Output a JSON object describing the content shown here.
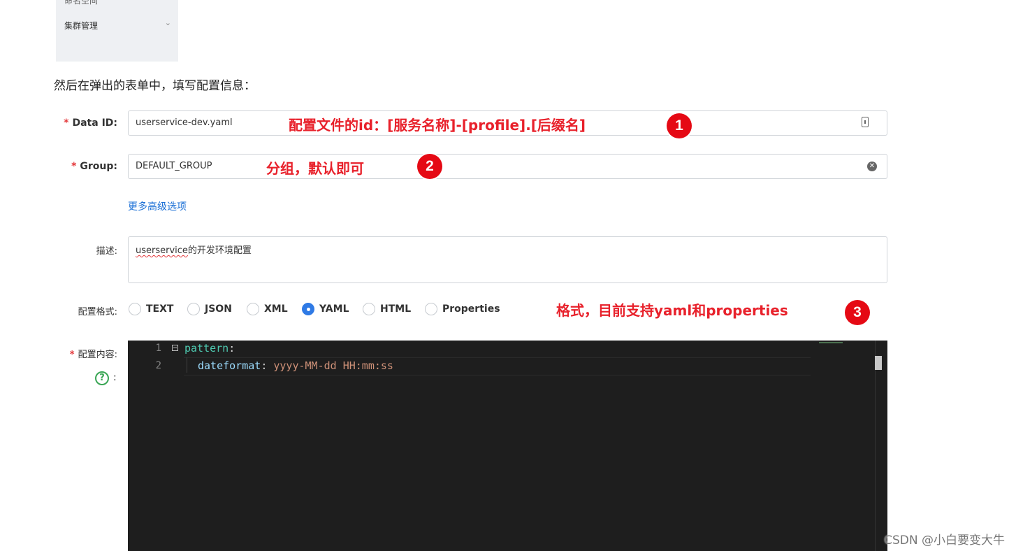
{
  "sidebar": {
    "partial_label": "命名空间",
    "item_label": "集群管理",
    "chevron": "chevron-down-icon"
  },
  "intro_text": "然后在弹出的表单中，填写配置信息：",
  "form": {
    "data_id": {
      "required_mark": "*",
      "label": "Data ID:",
      "value": "userservice-dev.yaml",
      "annotation": "配置文件的id：[服务名称]-[profile].[后缀名]",
      "badge": "1"
    },
    "group": {
      "required_mark": "*",
      "label": "Group:",
      "value": "DEFAULT_GROUP",
      "annotation": "分组，默认即可",
      "badge": "2"
    },
    "advanced_link": "更多高级选项",
    "description": {
      "label": "描述:",
      "value_underlined": "userservice",
      "value_rest": "的开发环境配置"
    },
    "format": {
      "label": "配置格式:",
      "options": [
        "TEXT",
        "JSON",
        "XML",
        "YAML",
        "HTML",
        "Properties"
      ],
      "selected": "YAML",
      "annotation": "格式，目前支持yaml和properties",
      "badge": "3"
    },
    "content": {
      "required_mark": "*",
      "label": "配置内容:",
      "help_colon": ":",
      "lines": [
        {
          "number": "1",
          "key": "pattern",
          "colon": ":"
        },
        {
          "number": "2",
          "key": "dateformat",
          "colon": ": ",
          "value": "yyyy-MM-dd HH:mm:ss"
        }
      ]
    }
  },
  "watermark": "CSDN @小白要变大牛",
  "colors": {
    "required": "#e4393c",
    "annotation": "#e8212b",
    "badge": "#e50914",
    "link": "#1a6fd6",
    "radio_selected": "#2f7ae5",
    "editor_bg": "#1e1e1e"
  }
}
